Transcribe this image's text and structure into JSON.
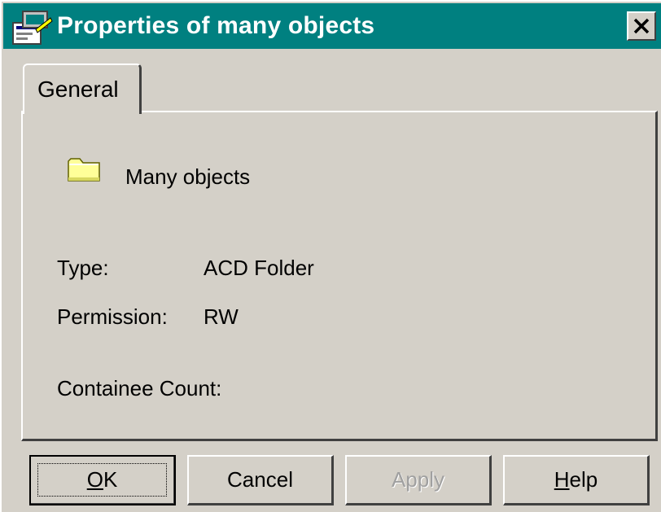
{
  "window": {
    "title": "Properties of many objects",
    "close_icon": "close-icon"
  },
  "tabs": [
    {
      "label": "General",
      "selected": true
    }
  ],
  "general": {
    "object_name": "Many objects",
    "object_icon": "folder-icon",
    "type_label": "Type:",
    "type_value": "ACD Folder",
    "permission_label": "Permission:",
    "permission_value": "RW",
    "count_label": "Containee Count:",
    "count_value": ""
  },
  "buttons": {
    "ok_mnemonic": "O",
    "ok_rest": "K",
    "cancel": "Cancel",
    "apply": "Apply",
    "help_mnemonic": "H",
    "help_rest": "elp"
  },
  "colors": {
    "titlebar": "#008080",
    "face": "#d4d0c8"
  }
}
